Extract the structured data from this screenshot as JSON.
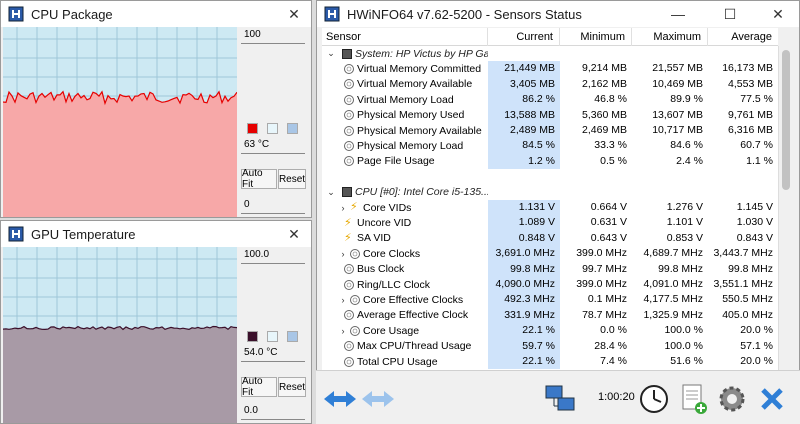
{
  "cpu_window": {
    "title": "CPU Package",
    "max_label": "100",
    "min_label": "0",
    "current": "63 °C",
    "autofit": "Auto Fit",
    "reset": "Reset",
    "colors": {
      "line": "#e60000",
      "fill": "#f7a8a8",
      "background": "#cde9f3"
    }
  },
  "gpu_window": {
    "title": "GPU Temperature",
    "max_label": "100.0",
    "min_label": "0.0",
    "current": "54.0 °C",
    "autofit": "Auto Fit",
    "reset": "Reset",
    "colors": {
      "line": "#3a0f2a",
      "fill": "#a89aa6",
      "background": "#cde9f3"
    }
  },
  "sensors": {
    "title": "HWiNFO64 v7.62-5200 - Sensors Status",
    "columns": [
      "Sensor",
      "Current",
      "Minimum",
      "Maximum",
      "Average"
    ],
    "rows": [
      {
        "type": "group",
        "name": "System: HP Victus by HP Ga..."
      },
      {
        "name": "Virtual Memory Committed",
        "cur": "21,449 MB",
        "min": "9,214 MB",
        "max": "21,557 MB",
        "avg": "16,173 MB"
      },
      {
        "name": "Virtual Memory Available",
        "cur": "3,405 MB",
        "min": "2,162 MB",
        "max": "10,469 MB",
        "avg": "4,553 MB"
      },
      {
        "name": "Virtual Memory Load",
        "cur": "86.2 %",
        "min": "46.8 %",
        "max": "89.9 %",
        "avg": "77.5 %"
      },
      {
        "name": "Physical Memory Used",
        "cur": "13,588 MB",
        "min": "5,360 MB",
        "max": "13,607 MB",
        "avg": "9,761 MB"
      },
      {
        "name": "Physical Memory Available",
        "cur": "2,489 MB",
        "min": "2,469 MB",
        "max": "10,717 MB",
        "avg": "6,316 MB"
      },
      {
        "name": "Physical Memory Load",
        "cur": "84.5 %",
        "min": "33.3 %",
        "max": "84.6 %",
        "avg": "60.7 %"
      },
      {
        "name": "Page File Usage",
        "cur": "1.2 %",
        "min": "0.5 %",
        "max": "2.4 %",
        "avg": "1.1 %"
      },
      {
        "type": "blank"
      },
      {
        "type": "group",
        "name": "CPU [#0]: Intel Core i5-135..."
      },
      {
        "name": "Core VIDs",
        "icon": "bolt",
        "expand": true,
        "cur": "1.131 V",
        "min": "0.664 V",
        "max": "1.276 V",
        "avg": "1.145 V"
      },
      {
        "name": "Uncore VID",
        "icon": "bolt",
        "cur": "1.089 V",
        "min": "0.631 V",
        "max": "1.101 V",
        "avg": "1.030 V"
      },
      {
        "name": "SA VID",
        "icon": "bolt",
        "cur": "0.848 V",
        "min": "0.643 V",
        "max": "0.853 V",
        "avg": "0.843 V"
      },
      {
        "name": "Core Clocks",
        "expand": true,
        "cur": "3,691.0 MHz",
        "min": "399.0 MHz",
        "max": "4,689.7 MHz",
        "avg": "3,443.7 MHz"
      },
      {
        "name": "Bus Clock",
        "cur": "99.8 MHz",
        "min": "99.7 MHz",
        "max": "99.8 MHz",
        "avg": "99.8 MHz"
      },
      {
        "name": "Ring/LLC Clock",
        "cur": "4,090.0 MHz",
        "min": "399.0 MHz",
        "max": "4,091.0 MHz",
        "avg": "3,551.1 MHz"
      },
      {
        "name": "Core Effective Clocks",
        "expand": true,
        "cur": "492.3 MHz",
        "min": "0.1 MHz",
        "max": "4,177.5 MHz",
        "avg": "550.5 MHz"
      },
      {
        "name": "Average Effective Clock",
        "cur": "331.9 MHz",
        "min": "78.7 MHz",
        "max": "1,325.9 MHz",
        "avg": "405.0 MHz"
      },
      {
        "name": "Core Usage",
        "expand": true,
        "cur": "22.1 %",
        "min": "0.0 %",
        "max": "100.0 %",
        "avg": "20.0 %"
      },
      {
        "name": "Max CPU/Thread Usage",
        "cur": "59.7 %",
        "min": "28.4 %",
        "max": "100.0 %",
        "avg": "57.1 %"
      },
      {
        "name": "Total CPU Usage",
        "cur": "22.1 %",
        "min": "7.4 %",
        "max": "51.6 %",
        "avg": "20.0 %"
      }
    ],
    "timer": "1:00:20"
  }
}
